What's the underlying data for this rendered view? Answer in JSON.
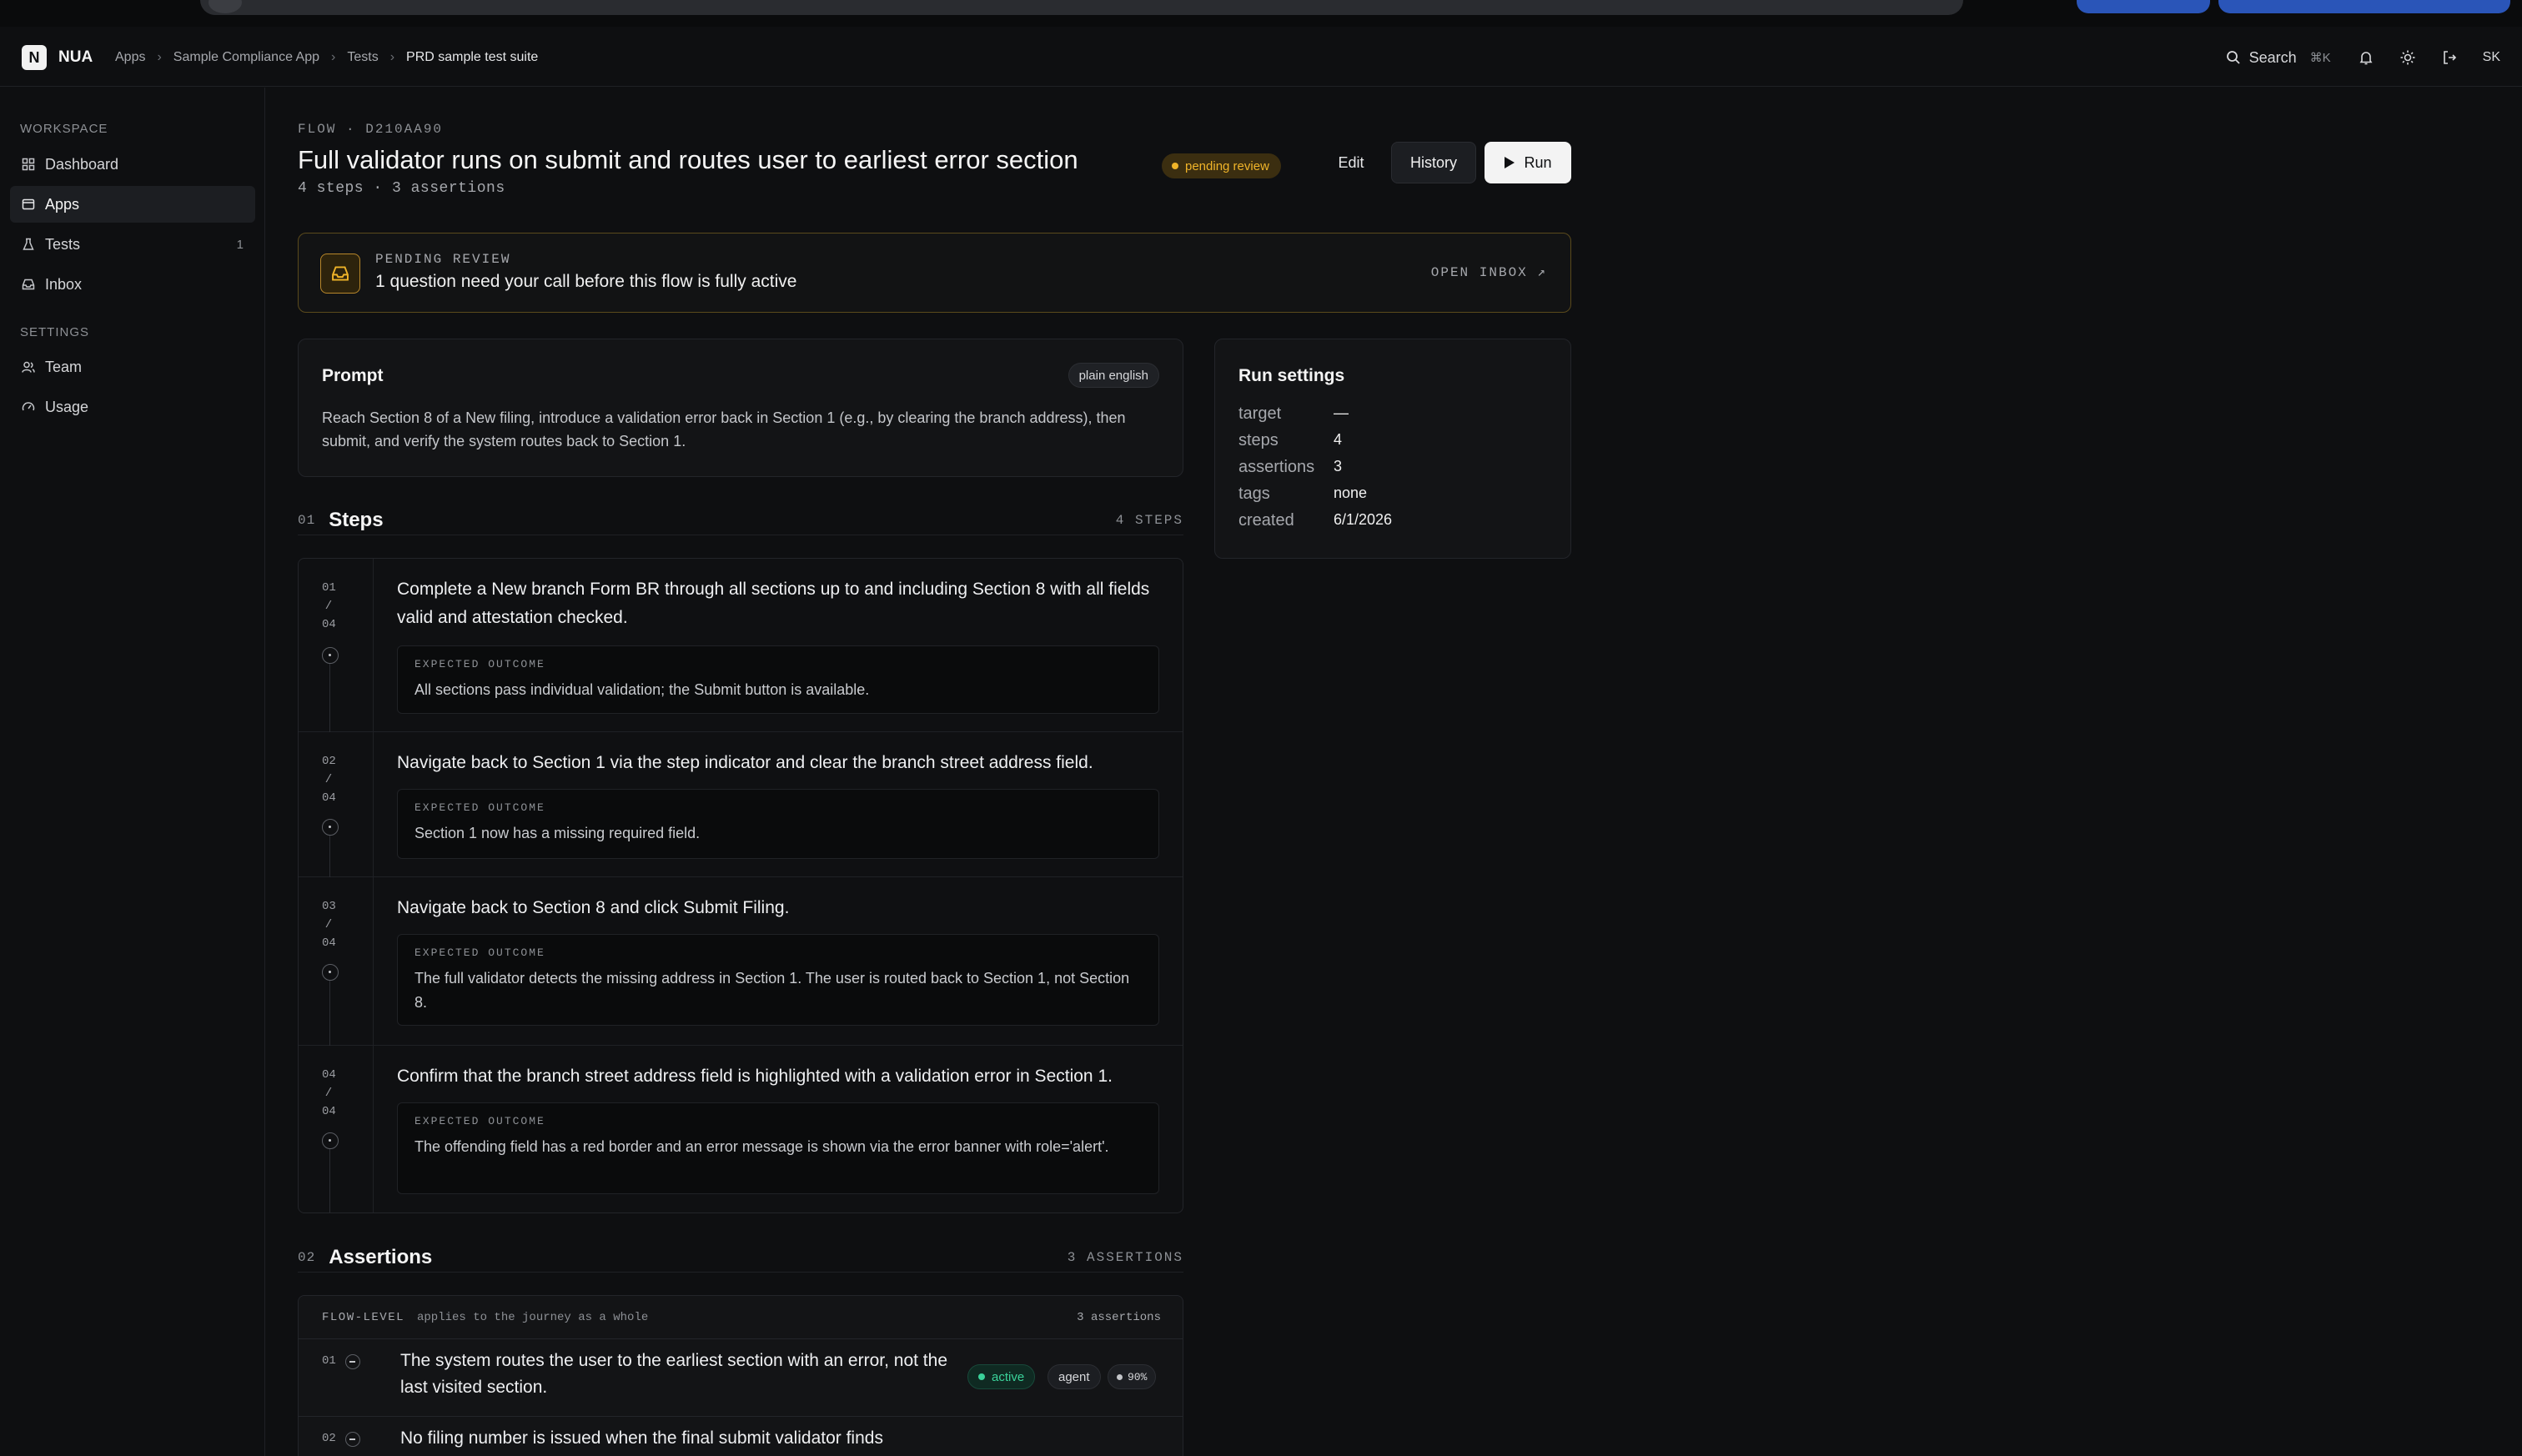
{
  "app": {
    "logo_letter": "N",
    "name": "NUA"
  },
  "breadcrumb": [
    "Apps",
    "Sample Compliance App",
    "Tests",
    "PRD sample test suite"
  ],
  "topbar": {
    "search_label": "Search",
    "search_shortcut": "⌘K",
    "user_initials": "SK"
  },
  "sidebar": {
    "workspace_label": "WORKSPACE",
    "items": [
      {
        "label": "Dashboard",
        "icon": "grid-icon"
      },
      {
        "label": "Apps",
        "icon": "window-icon",
        "active": true
      },
      {
        "label": "Tests",
        "icon": "flask-icon",
        "count": "1"
      },
      {
        "label": "Inbox",
        "icon": "inbox-icon"
      }
    ],
    "settings_label": "SETTINGS",
    "settings_items": [
      {
        "label": "Team",
        "icon": "users-icon"
      },
      {
        "label": "Usage",
        "icon": "gauge-icon"
      }
    ]
  },
  "flow": {
    "kicker": "FLOW · D210AA90",
    "title": "Full validator runs on submit and routes user to earliest error section",
    "status": "pending review",
    "summary": "4 steps · 3 assertions",
    "actions": {
      "edit": "Edit",
      "history": "History",
      "run": "Run"
    }
  },
  "banner": {
    "label": "PENDING REVIEW",
    "message": "1 question need your call before this flow is fully active",
    "link": "OPEN INBOX ↗"
  },
  "prompt": {
    "title": "Prompt",
    "tag": "plain english",
    "text": "Reach Section 8 of a New filing, introduce a validation error back in Section 1 (e.g., by clearing the branch address), then submit, and verify the system routes back to Section 1."
  },
  "run_settings": {
    "title": "Run settings",
    "rows": [
      {
        "key": "target",
        "value": "—"
      },
      {
        "key": "steps",
        "value": "4"
      },
      {
        "key": "assertions",
        "value": "3"
      },
      {
        "key": "tags",
        "value": "none"
      },
      {
        "key": "created",
        "value": "6/1/2026"
      }
    ]
  },
  "steps_section": {
    "num": "01",
    "title": "Steps",
    "count": "4 STEPS"
  },
  "steps": [
    {
      "idx": [
        "01",
        "/",
        "04"
      ],
      "text": "Complete a New branch Form BR through all sections up to and including Section 8 with all fields valid and attestation checked.",
      "outcome_label": "EXPECTED OUTCOME",
      "outcome": "All sections pass individual validation; the Submit button is available."
    },
    {
      "idx": [
        "02",
        "/",
        "04"
      ],
      "text": "Navigate back to Section 1 via the step indicator and clear the branch street address field.",
      "outcome_label": "EXPECTED OUTCOME",
      "outcome": "Section 1 now has a missing required field."
    },
    {
      "idx": [
        "03",
        "/",
        "04"
      ],
      "text": "Navigate back to Section 8 and click Submit Filing.",
      "outcome_label": "EXPECTED OUTCOME",
      "outcome": "The full validator detects the missing address in Section 1. The user is routed back to Section 1, not Section 8."
    },
    {
      "idx": [
        "04",
        "/",
        "04"
      ],
      "text": "Confirm that the branch street address field is highlighted with a validation error in Section 1.",
      "outcome_label": "EXPECTED OUTCOME",
      "outcome": "The offending field has a red border and an error message is shown via the error banner with role='alert'."
    }
  ],
  "assertions_section": {
    "num": "02",
    "title": "Assertions",
    "count": "3 ASSERTIONS"
  },
  "assertions_group": {
    "label": "FLOW-LEVEL",
    "desc": "applies to the journey as a whole",
    "count": "3 assertions"
  },
  "assertions": [
    {
      "num": "01",
      "text": "The system routes the user to the earliest section with an error, not the last visited section.",
      "status": "active",
      "kind": "agent",
      "confidence": "90%"
    },
    {
      "num": "02",
      "text": "No filing number is issued when the final submit validator finds"
    }
  ],
  "colors": {
    "accent_pending": "#f0b429",
    "accent_active": "#3ad29a",
    "background": "#0e0f11"
  }
}
